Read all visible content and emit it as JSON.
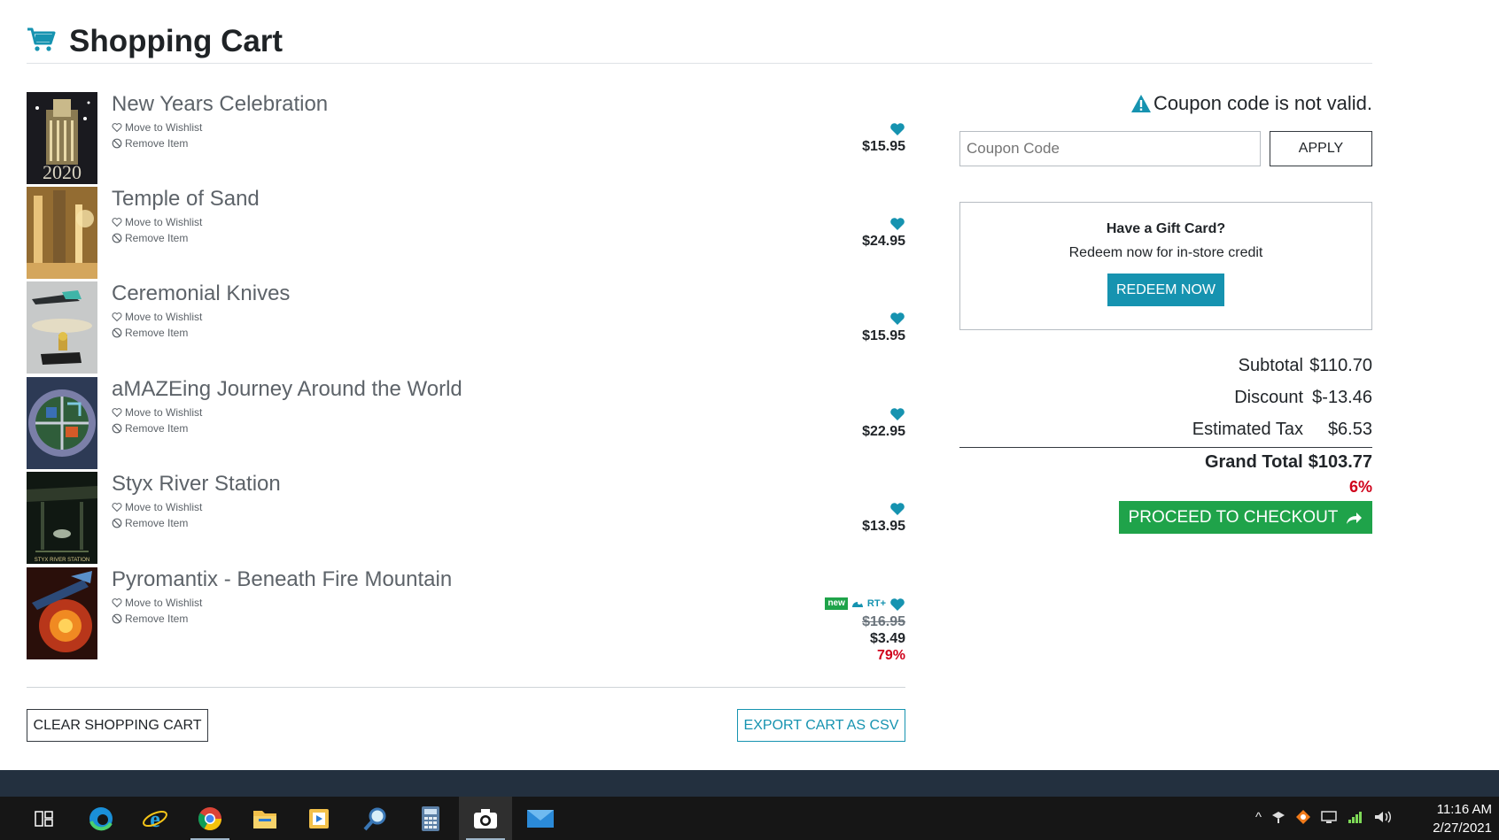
{
  "header": {
    "title": "Shopping Cart",
    "icon": "shopping-cart-icon"
  },
  "cart": {
    "wishlist_label": "Move to Wishlist",
    "remove_label": "Remove Item",
    "items": [
      {
        "title": "New Years Celebration",
        "price": "$15.95",
        "thumb_text": "2020"
      },
      {
        "title": "Temple of Sand",
        "price": "$24.95"
      },
      {
        "title": "Ceremonial Knives",
        "price": "$15.95"
      },
      {
        "title": "aMAZEing Journey Around the World",
        "price": "$22.95"
      },
      {
        "title": "Styx River Station",
        "price": "$13.95",
        "thumb_text": "STYX RIVER STATION"
      },
      {
        "title": "Pyromantix - Beneath Fire Mountain",
        "old_price": "$16.95",
        "sale_price": "$3.49",
        "discount": "79%",
        "badge_new": "new",
        "badge_rt": "RT+"
      }
    ],
    "clear_label": "CLEAR SHOPPING CART",
    "export_label": "EXPORT CART AS CSV"
  },
  "coupon": {
    "message": "Coupon code is not valid.",
    "placeholder": "Coupon Code",
    "apply_label": "APPLY"
  },
  "gift": {
    "title": "Have a Gift Card?",
    "subtitle": "Redeem now for in-store credit",
    "button": "REDEEM NOW"
  },
  "summary": {
    "subtotal_label": "Subtotal",
    "subtotal": "$110.70",
    "discount_label": "Discount",
    "discount": "$-13.46",
    "tax_label": "Estimated Tax",
    "tax": "$6.53",
    "grand_label": "Grand Total",
    "grand": "$103.77",
    "grand_pct": "6%",
    "checkout_label": "PROCEED TO CHECKOUT"
  },
  "colors": {
    "accent": "#1693b0",
    "success": "#1fa34a",
    "danger": "#d0021b"
  },
  "taskbar": {
    "time": "11:16 AM",
    "date": "2/27/2021"
  }
}
